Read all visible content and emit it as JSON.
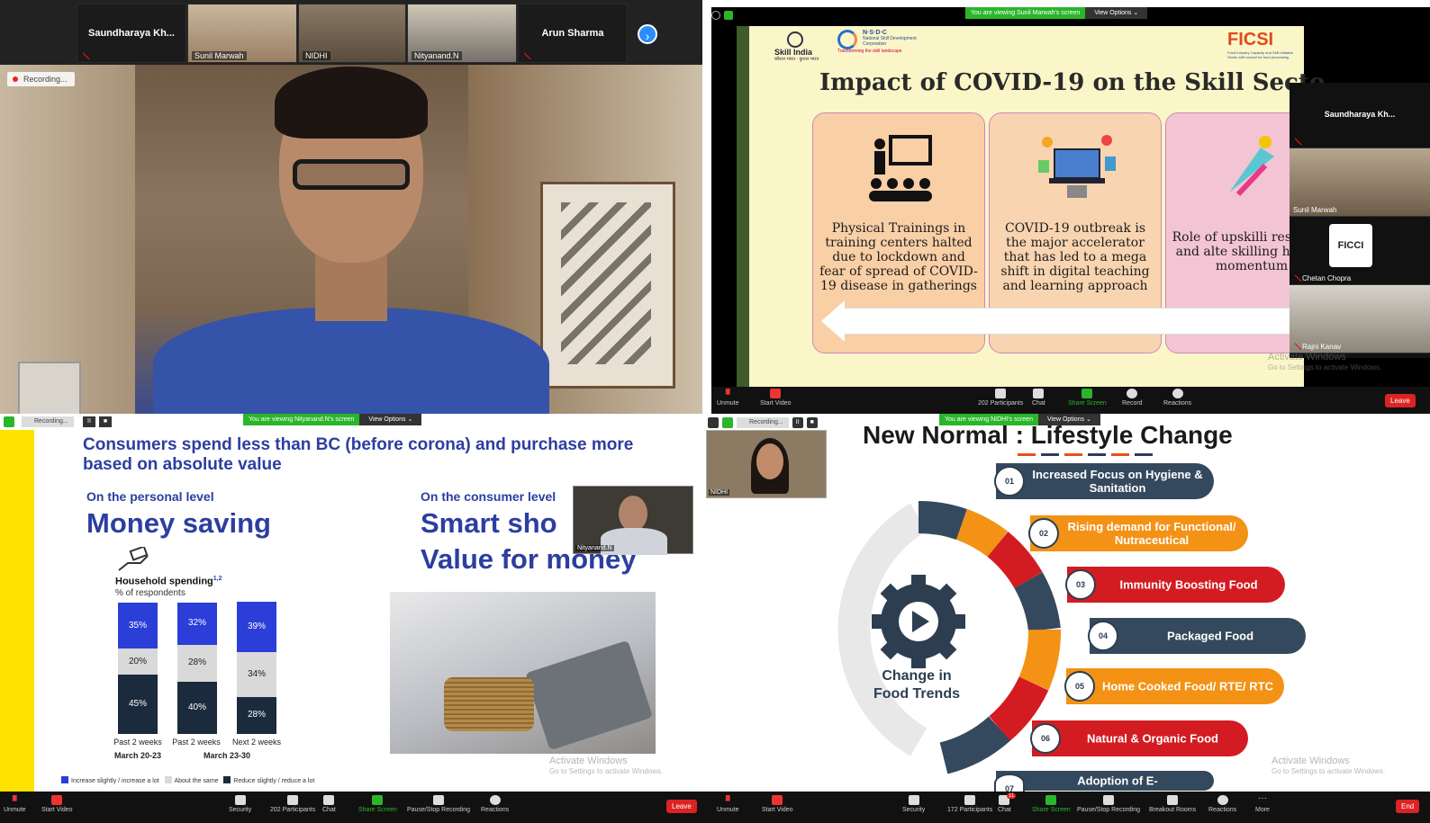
{
  "q1": {
    "strip_tiles": [
      {
        "name": "Saundharaya  Kh...",
        "label": ""
      },
      {
        "name": "",
        "label": "Sunil Marwah"
      },
      {
        "name": "",
        "label": "NIDHI"
      },
      {
        "name": "",
        "label": "Nityanand.N"
      },
      {
        "name": "Arun Sharma",
        "label": ""
      }
    ],
    "next_arrow": "›",
    "recording": "Recording..."
  },
  "q2": {
    "viewing": "You are viewing Sunil Marwah's screen",
    "view_options": "View Options ⌄",
    "logos": {
      "skill_india": "Skill India",
      "skill_india_sub": "कौशल भारत - कुशल भारत",
      "nsdc": "N·S·D·C",
      "nsdc_name": "National Skill Development Corporation",
      "nsdc_tag": "Transforming the skill landscape",
      "ficsi": "FICSI",
      "ficsi_sub": "Food Industry Capacity and Skill Initiative",
      "ficsi_sub2": "Sector skill council for food processing"
    },
    "title": "Impact of COVID-19 on the Skill Secto",
    "cards": [
      {
        "text": "Physical Trainings in training centers halted due to lockdown and fear of spread of COVID-19 disease in gatherings",
        "color": "#f9cfa6"
      },
      {
        "text": "COVID-19 outbreak is the major accelerator that has led to a mega shift in digital teaching and learning approach",
        "color": "#f8d4b0"
      },
      {
        "text": "Role of upskilli reskilling and alte skilling  has gai momentum",
        "color": "#f3c4d4"
      }
    ],
    "side_tiles": [
      {
        "name": "Saundharaya  Kh...",
        "label": ""
      },
      {
        "name": "",
        "label": "Sunil Marwah"
      },
      {
        "name": "FICCI",
        "label": "Chetan Chopra"
      },
      {
        "name": "",
        "label": "Rajni Kanav"
      }
    ],
    "activate_title": "Activate Windows",
    "activate_sub": "Go to Settings to activate Windows.",
    "toolbar": {
      "unmute": "Unmute",
      "start_video": "Start Video",
      "participants_count": "202",
      "participants": "Participants",
      "chat": "Chat",
      "share_screen": "Share Screen",
      "record": "Record",
      "reactions": "Reactions",
      "leave": "Leave"
    }
  },
  "q3": {
    "recording": "Recording...",
    "pause": "II",
    "stop": "■",
    "viewing": "You are viewing Nityanand.N's screen",
    "view_options": "View Options ⌄",
    "title": "Consumers spend less than BC (before corona) and purchase more based on absolute value",
    "left_subhead": "On the personal level",
    "left_big": "Money saving",
    "right_subhead": "On the consumer level",
    "right_big1": "Smart sho",
    "right_big2": "Value for money",
    "pip_label": "Nityanand.N",
    "activate_title": "Activate Windows",
    "activate_sub": "Go to Settings to activate Windows.",
    "chart_data": {
      "type": "bar",
      "title": "Household spending",
      "title_sup": "1,2",
      "subtitle": "% of respondents",
      "categories": [
        "Past 2 weeks",
        "Past 2 weeks",
        "Next 2 weeks"
      ],
      "group_labels": [
        "March 20-23",
        "March 23-30"
      ],
      "series": [
        {
          "name": "Reduce slightly / reduce a lot",
          "values": [
            45,
            40,
            28
          ],
          "color": "#1b2a3c"
        },
        {
          "name": "About the same",
          "values": [
            20,
            28,
            34
          ],
          "color": "#d9d9d9"
        },
        {
          "name": "Increase slightly / increase a lot",
          "values": [
            35,
            32,
            39
          ],
          "color": "#2c3ed8"
        }
      ]
    },
    "toolbar": {
      "unmute": "Unmute",
      "start_video": "Start Video",
      "security": "Security",
      "participants_count": "202",
      "participants": "Participants",
      "chat": "Chat",
      "share_screen": "Share Screen",
      "pause_share": "Pause/Stop Recording",
      "reactions": "Reactions",
      "leave": "Leave"
    }
  },
  "q4": {
    "recording": "Recording...",
    "pause": "II",
    "stop": "■",
    "viewing": "You are viewing NIDHI's screen",
    "view_options": "View Options ⌄",
    "nidhi_label": "NIDHI",
    "title": "New Normal : Lifestyle Change",
    "center_label": "Change in Food Trends",
    "items": [
      {
        "num": "01",
        "text": "Increased Focus on Hygiene & Sanitation"
      },
      {
        "num": "02",
        "text": "Rising demand for Functional/ Nutraceutical"
      },
      {
        "num": "03",
        "text": "Immunity Boosting Food"
      },
      {
        "num": "04",
        "text": "Packaged Food"
      },
      {
        "num": "05",
        "text": "Home Cooked Food/ RTE/ RTC"
      },
      {
        "num": "06",
        "text": "Natural & Organic Food"
      },
      {
        "num": "07",
        "text": "Adoption of E-"
      }
    ],
    "activate_title": "Activate Windows",
    "activate_sub": "Go to Settings to activate Windows.",
    "toolbar": {
      "unmute": "Unmute",
      "start_video": "Start Video",
      "security": "Security",
      "participants_count": "172",
      "participants": "Participants",
      "chat_badge": "11",
      "chat": "Chat",
      "share_screen": "Share Screen",
      "pause_share": "Pause/Stop Recording",
      "breakout": "Breakout Rooms",
      "reactions": "Reactions",
      "more": "More",
      "end": "End"
    }
  }
}
